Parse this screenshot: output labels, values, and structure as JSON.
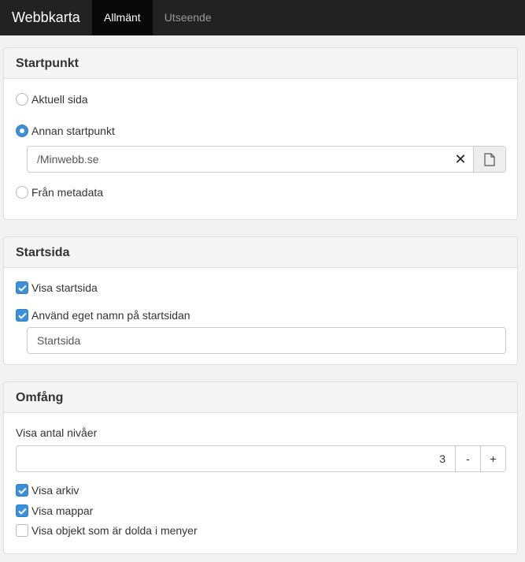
{
  "navbar": {
    "brand": "Webbkarta",
    "tabs": [
      {
        "label": "Allmänt",
        "active": true
      },
      {
        "label": "Utseende",
        "active": false
      }
    ]
  },
  "startpunkt": {
    "title": "Startpunkt",
    "options": [
      {
        "label": "Aktuell sida",
        "checked": false
      },
      {
        "label": "Annan startpunkt",
        "checked": true
      },
      {
        "label": "Från metadata",
        "checked": false
      }
    ],
    "path_value": "/Minwebb.se",
    "clear_symbol": "✕"
  },
  "startsida": {
    "title": "Startsida",
    "show_startpage": {
      "label": "Visa startsida",
      "checked": true
    },
    "custom_name": {
      "label": "Använd eget namn på startsidan",
      "checked": true
    },
    "name_value": "Startsida"
  },
  "omfang": {
    "title": "Omfång",
    "levels_label": "Visa antal nivåer",
    "levels_value": "3",
    "minus_label": "-",
    "plus_label": "+",
    "checks": [
      {
        "label": "Visa arkiv",
        "checked": true
      },
      {
        "label": "Visa mappar",
        "checked": true
      },
      {
        "label": "Visa objekt som är dolda i menyer",
        "checked": false
      }
    ]
  },
  "colors": {
    "navbar_bg": "#222222",
    "active_tab_bg": "#080808",
    "accent": "#3d8fd9"
  }
}
